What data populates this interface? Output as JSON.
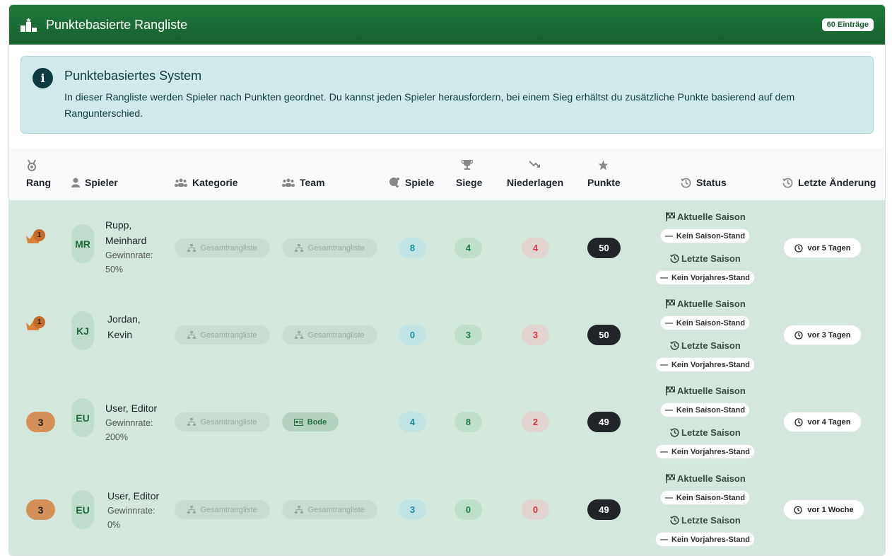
{
  "header": {
    "title": "Punktebasierte Rangliste",
    "count_badge": "60 Einträge"
  },
  "info": {
    "title": "Punktebasiertes System",
    "text": "In dieser Rangliste werden Spieler nach Punkten geordnet. Du kannst jeden Spieler herausfordern, bei einem Sieg erhältst du zusätzliche Punkte basierend auf dem Rangunterschied."
  },
  "columns": {
    "rang": "Rang",
    "spieler": "Spieler",
    "kategorie": "Kategorie",
    "team": "Team",
    "spiele": "Spiele",
    "siege": "Siege",
    "niederlagen": "Niederlagen",
    "punkte": "Punkte",
    "status": "Status",
    "letzte": "Letzte Änderung"
  },
  "status_labels": {
    "current": "Aktuelle Saison",
    "current_value": "Kein Saison-Stand",
    "last": "Letzte Saison",
    "last_value": "Kein Vorjahres-Stand"
  },
  "rows": [
    {
      "rank": "1",
      "rank_style": "crown",
      "initials": "MR",
      "name_line1": "Rupp,",
      "name_line2": "Meinhard",
      "rate_label": "Gewinnrate:",
      "rate_value": "50%",
      "kategorie": "Gesamtrangliste",
      "team": "Gesamtrangliste",
      "spiele": "8",
      "siege": "4",
      "niederlagen": "4",
      "punkte": "50",
      "changed": "vor 5 Tagen"
    },
    {
      "rank": "1",
      "rank_style": "crown",
      "initials": "KJ",
      "name_line1": "Jordan,",
      "name_line2": "Kevin",
      "rate_label": "",
      "rate_value": "",
      "kategorie": "Gesamtrangliste",
      "team": "Gesamtrangliste",
      "spiele": "0",
      "siege": "3",
      "niederlagen": "3",
      "punkte": "50",
      "changed": "vor 3 Tagen"
    },
    {
      "rank": "3",
      "rank_style": "pill",
      "initials": "EU",
      "name_line1": "User, Editor",
      "name_line2": "",
      "rate_label": "Gewinnrate:",
      "rate_value": "200%",
      "kategorie": "Gesamtrangliste",
      "team": "Bode",
      "spiele": "4",
      "siege": "8",
      "niederlagen": "2",
      "punkte": "49",
      "changed": "vor 4 Tagen"
    },
    {
      "rank": "3",
      "rank_style": "pill",
      "initials": "EU",
      "name_line1": "User, Editor",
      "name_line2": "",
      "rate_label": "Gewinnrate:",
      "rate_value": "0%",
      "kategorie": "Gesamtrangliste",
      "team": "Gesamtrangliste",
      "spiele": "3",
      "siege": "0",
      "niederlagen": "0",
      "punkte": "49",
      "changed": "vor 1 Woche"
    }
  ]
}
